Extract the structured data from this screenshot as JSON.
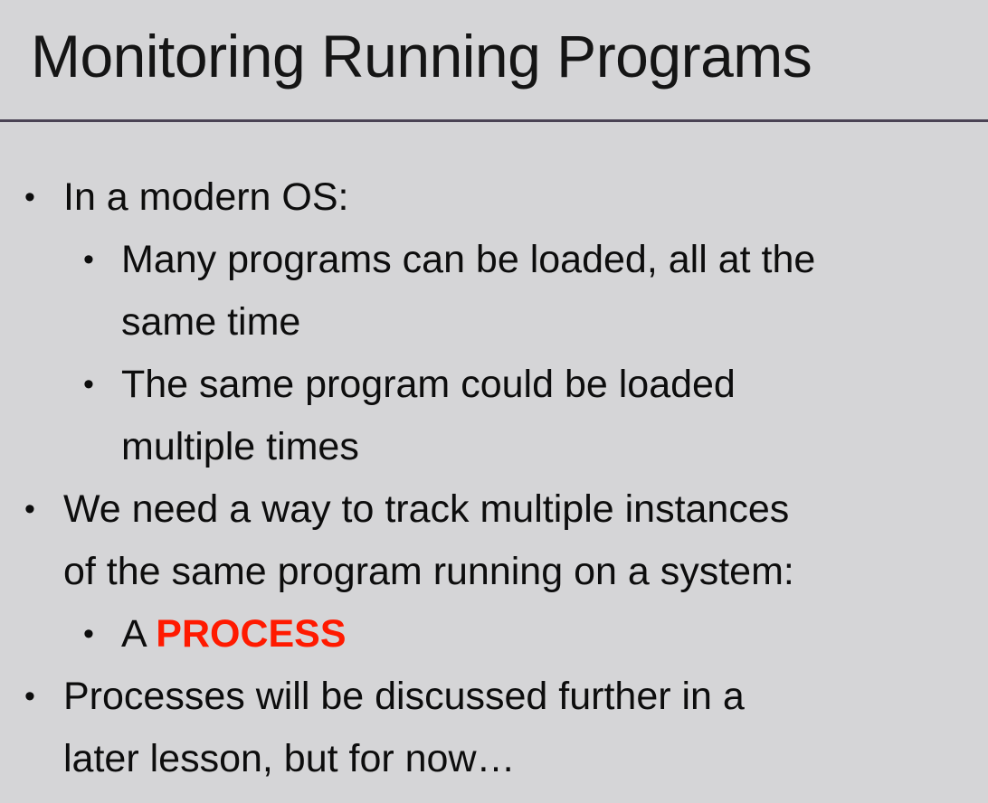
{
  "slide": {
    "title": "Monitoring Running Programs",
    "colors": {
      "background": "#d5d5d7",
      "divider": "#4a4354",
      "accent": "#ff1a00",
      "text": "#0d0d0d"
    },
    "bullets": [
      {
        "level": 1,
        "lines": [
          "In a modern OS:"
        ]
      },
      {
        "level": 2,
        "lines": [
          "Many programs can be loaded, all at the",
          "same time"
        ]
      },
      {
        "level": 2,
        "lines": [
          "The same program could be loaded",
          "multiple times"
        ]
      },
      {
        "level": 1,
        "lines": [
          "We need a way to track multiple instances",
          "of the same program running on a system:"
        ]
      },
      {
        "level": 2,
        "prefix": "A ",
        "highlight": "PROCESS"
      },
      {
        "level": 1,
        "lines": [
          "Processes will be discussed further in a",
          "later lesson, but for now…"
        ]
      }
    ]
  }
}
